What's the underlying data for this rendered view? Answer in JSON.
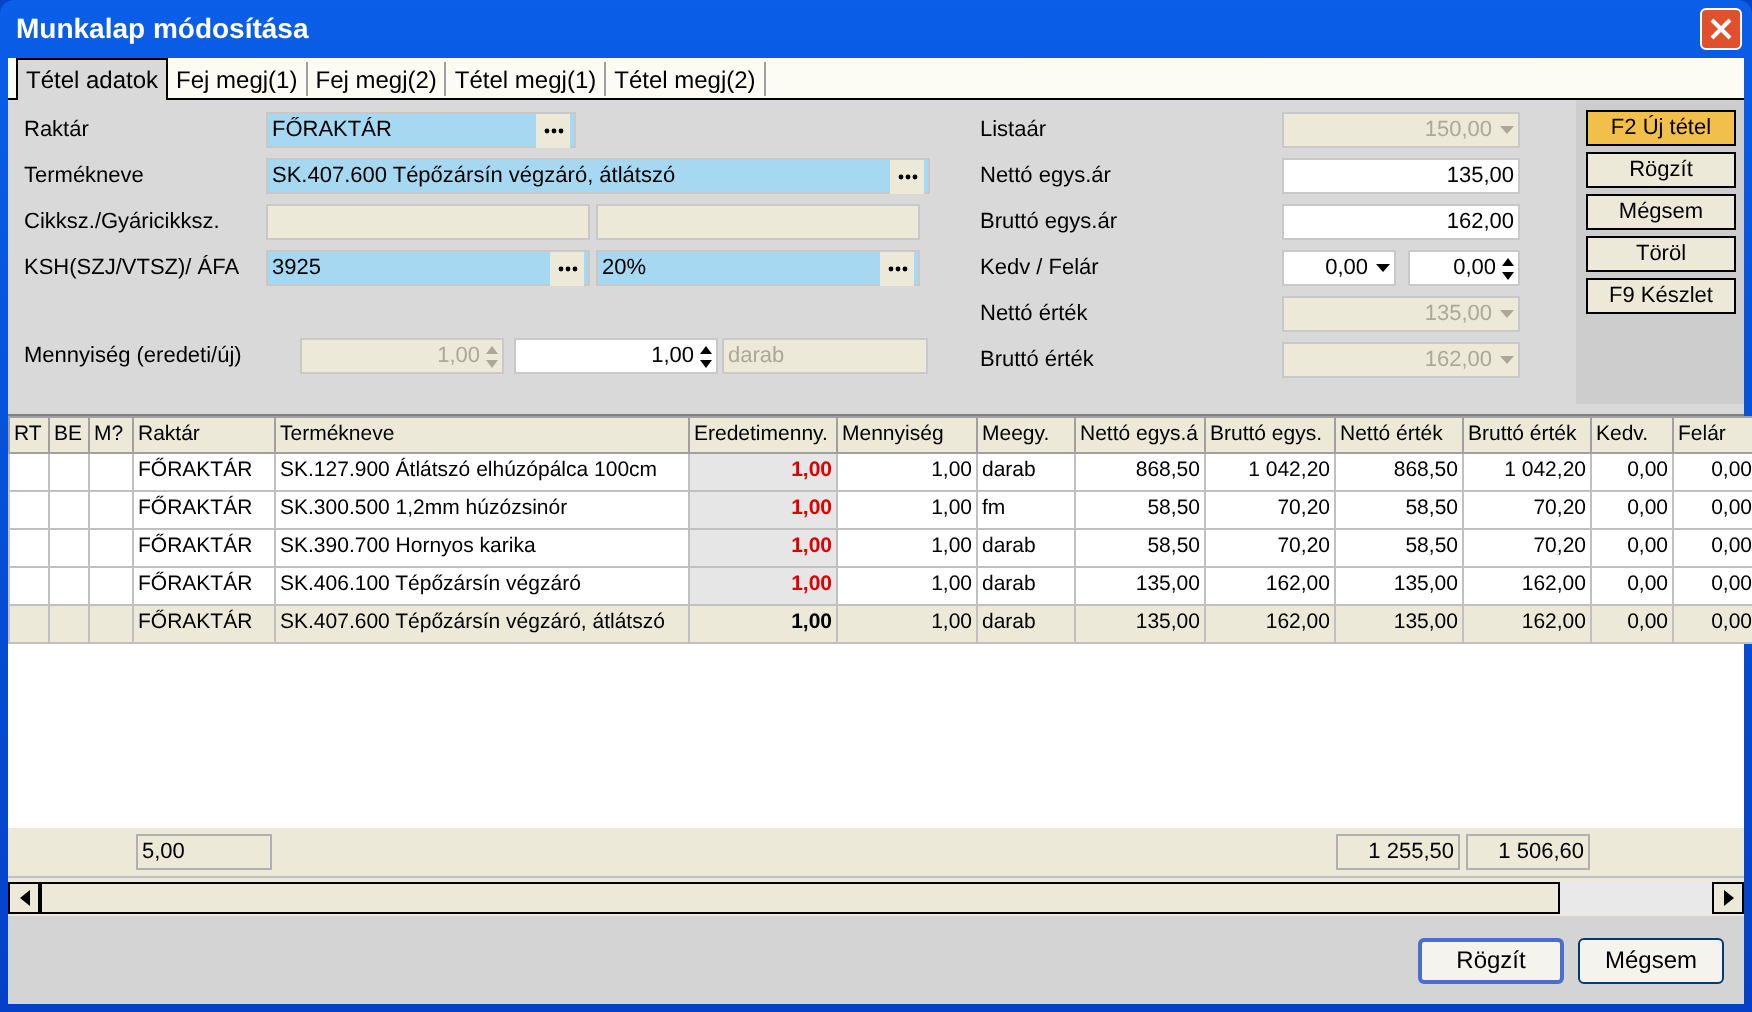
{
  "window": {
    "title": "Munkalap módosítása"
  },
  "tabs": [
    {
      "label": "Tétel adatok",
      "selected": true
    },
    {
      "label": "Fej megj(1)",
      "selected": false
    },
    {
      "label": "Fej megj(2)",
      "selected": false
    },
    {
      "label": "Tétel megj(1)",
      "selected": false
    },
    {
      "label": "Tétel megj(2)",
      "selected": false
    }
  ],
  "left_fields": [
    {
      "label": "Raktár",
      "inputs": [
        {
          "value": "FŐRAKTÁR",
          "kind": "lookup"
        }
      ]
    },
    {
      "label": "Termékneve",
      "inputs": [
        {
          "value": "SK.407.600 Tépőzársín végzáró, átlátszó",
          "kind": "lookup"
        }
      ]
    },
    {
      "label": "Cikksz./Gyáricikksz.",
      "inputs": [
        {
          "kind": "readonly"
        },
        {
          "kind": "readonly"
        }
      ]
    },
    {
      "label": "KSH(SZJ/VTSZ)/ ÁFA",
      "inputs": [
        {
          "value": "3925",
          "kind": "lookup"
        },
        {
          "value": "20%",
          "kind": "lookup"
        }
      ]
    }
  ],
  "quantity": {
    "label": "Mennyiség (eredeti/új)",
    "inputs": [
      {
        "value": "1,00",
        "kind": "spinner",
        "disabled": true
      },
      {
        "value": "1,00",
        "kind": "spinner",
        "disabled": false
      },
      {
        "value": "darab",
        "kind": "readonly",
        "disabled": true
      }
    ]
  },
  "right_fields": [
    {
      "label": "Listaár",
      "inputs": [
        {
          "value": "150,00",
          "kind": "dropdown",
          "disabled": true
        }
      ]
    },
    {
      "label": "Nettó egys.ár",
      "inputs": [
        {
          "value": "135,00",
          "kind": "text",
          "disabled": false
        }
      ]
    },
    {
      "label": "Bruttó egys.ár",
      "inputs": [
        {
          "value": "162,00",
          "kind": "text",
          "disabled": false
        }
      ]
    },
    {
      "label": "Kedv / Felár",
      "inputs": [
        {
          "value": "0,00",
          "kind": "dropdown",
          "disabled": false
        },
        {
          "value": "0,00",
          "kind": "spinner",
          "disabled": false
        }
      ]
    },
    {
      "label": "Nettó érték",
      "inputs": [
        {
          "value": "135,00",
          "kind": "dropdown",
          "disabled": true
        }
      ]
    },
    {
      "label": "Bruttó érték",
      "inputs": [
        {
          "value": "162,00",
          "kind": "dropdown",
          "disabled": true
        }
      ]
    }
  ],
  "side_buttons": [
    {
      "label": "F2 Új tétel",
      "highlighted": true
    },
    {
      "label": "Rögzít",
      "highlighted": false
    },
    {
      "label": "Mégsem",
      "highlighted": false
    },
    {
      "label": "Töröl",
      "highlighted": false
    },
    {
      "label": "F9 Készlet",
      "highlighted": false
    }
  ],
  "table": {
    "columns": [
      "RT",
      "BE",
      "M?",
      "Raktár",
      "Termékneve",
      "Eredetimenny.",
      "Mennyiség",
      "Meegy.",
      "Nettó egys.á",
      "Bruttó egys.",
      "Nettó érték",
      "Bruttó érték",
      "Kedv.",
      "Felár"
    ],
    "rows": [
      {
        "raktar": "FŐRAKTÁR",
        "termekneve": "SK.127.900 Átlátszó elhúzópálca 100cm",
        "eredetimenny": "1,00",
        "mennyiseg": "1,00",
        "meegy": "darab",
        "netto_egysar": "868,50",
        "brutto_egysar": "1 042,20",
        "netto_ertek": "868,50",
        "brutto_ertek": "1 042,20",
        "kedv": "0,00",
        "felar": "0,00",
        "selected": false
      },
      {
        "raktar": "FŐRAKTÁR",
        "termekneve": "SK.300.500 1,2mm húzózsinór",
        "eredetimenny": "1,00",
        "mennyiseg": "1,00",
        "meegy": "fm",
        "netto_egysar": "58,50",
        "brutto_egysar": "70,20",
        "netto_ertek": "58,50",
        "brutto_ertek": "70,20",
        "kedv": "0,00",
        "felar": "0,00",
        "selected": false
      },
      {
        "raktar": "FŐRAKTÁR",
        "termekneve": "SK.390.700 Hornyos karika",
        "eredetimenny": "1,00",
        "mennyiseg": "1,00",
        "meegy": "darab",
        "netto_egysar": "58,50",
        "brutto_egysar": "70,20",
        "netto_ertek": "58,50",
        "brutto_ertek": "70,20",
        "kedv": "0,00",
        "felar": "0,00",
        "selected": false
      },
      {
        "raktar": "FŐRAKTÁR",
        "termekneve": "SK.406.100 Tépőzársín végzáró",
        "eredetimenny": "1,00",
        "mennyiseg": "1,00",
        "meegy": "darab",
        "netto_egysar": "135,00",
        "brutto_egysar": "162,00",
        "netto_ertek": "135,00",
        "brutto_ertek": "162,00",
        "kedv": "0,00",
        "felar": "0,00",
        "selected": false
      },
      {
        "raktar": "FŐRAKTÁR",
        "termekneve": "SK.407.600 Tépőzársín végzáró, átlátszó",
        "eredetimenny": "1,00",
        "mennyiseg": "1,00",
        "meegy": "darab",
        "netto_egysar": "135,00",
        "brutto_egysar": "162,00",
        "netto_ertek": "135,00",
        "brutto_ertek": "162,00",
        "kedv": "0,00",
        "felar": "0,00",
        "selected": true
      }
    ],
    "totals": {
      "count": "5,00",
      "netto_ertek": "1 255,50",
      "brutto_ertek": "1 506,60"
    }
  },
  "buttons": [
    {
      "label": "Rögzít",
      "default": true
    },
    {
      "label": "Mégsem",
      "default": false
    }
  ]
}
